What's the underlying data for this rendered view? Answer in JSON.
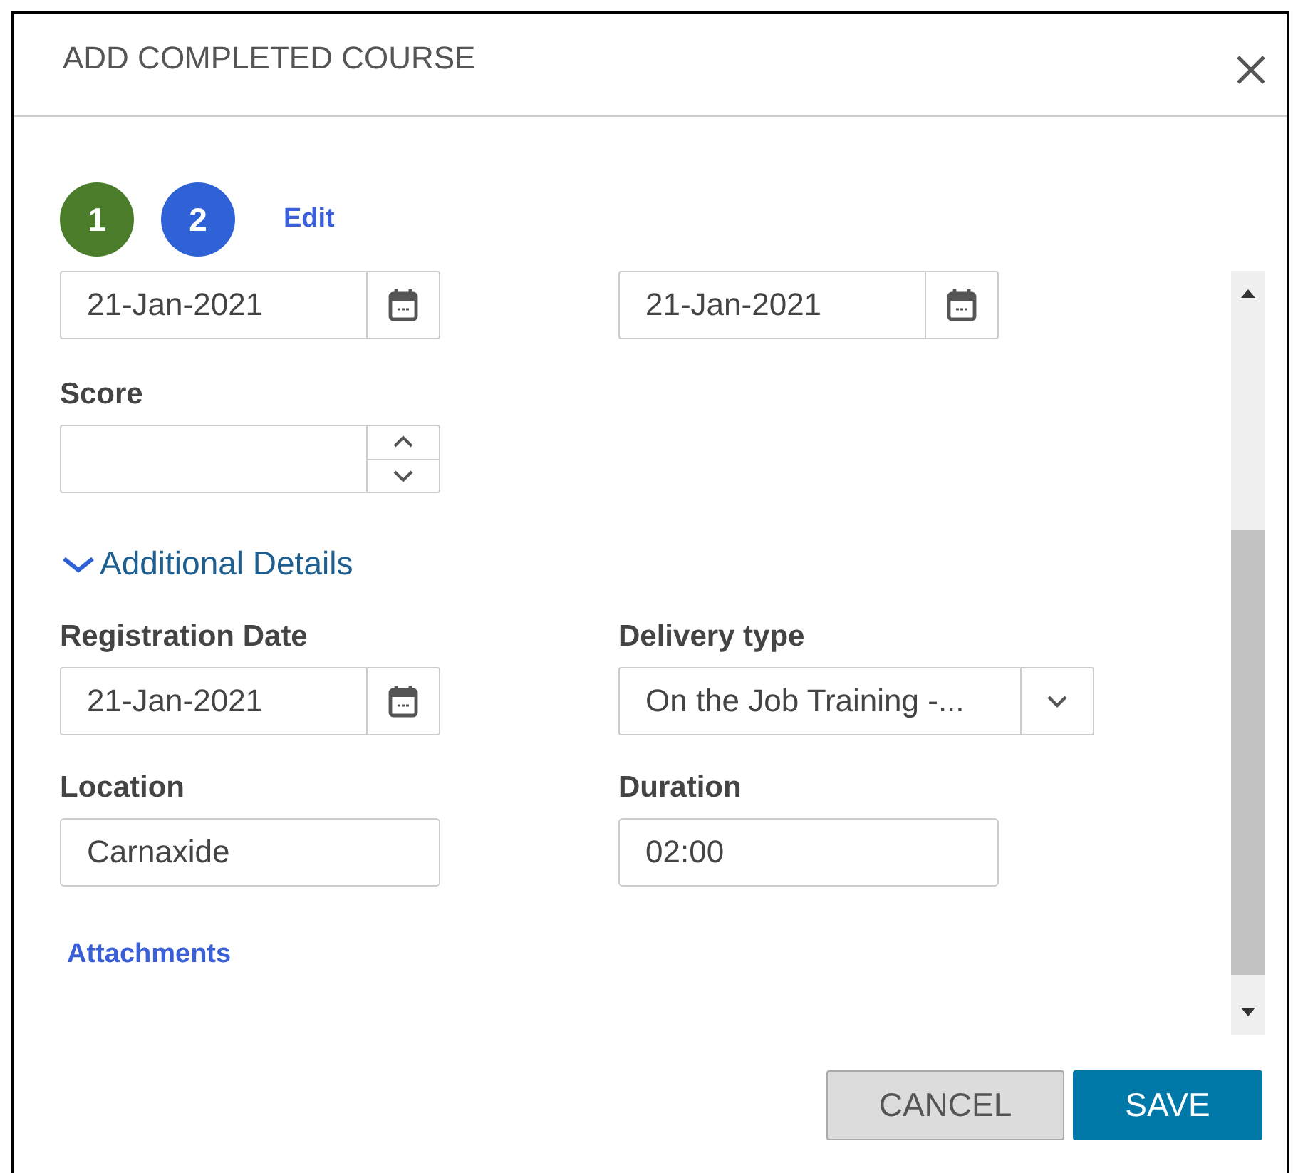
{
  "dialog": {
    "title": "ADD COMPLETED COURSE"
  },
  "steps": [
    {
      "label": "1",
      "selected": false
    },
    {
      "label": "2",
      "selected": true
    }
  ],
  "edit_link": "Edit",
  "top_dates": [
    {
      "value": "21-Jan-2021"
    },
    {
      "value": "21-Jan-2021"
    }
  ],
  "score": {
    "label": "Score"
  },
  "additional_details": {
    "label": "Additional Details",
    "expanded": true
  },
  "fields": [
    {
      "label": "Registration Date",
      "value": "21-Jan-2021",
      "kind": "date"
    },
    {
      "label": "Delivery type",
      "value": "On the Job Training -...",
      "kind": "select"
    },
    {
      "label": "Location",
      "value": "Carnaxide",
      "kind": "text"
    },
    {
      "label": "Duration",
      "value": "02:00",
      "kind": "text"
    }
  ],
  "attachments_link": "Attachments",
  "buttons": [
    {
      "label": "CANCEL",
      "kind": "secondary"
    },
    {
      "label": "SAVE",
      "kind": "primary"
    }
  ]
}
